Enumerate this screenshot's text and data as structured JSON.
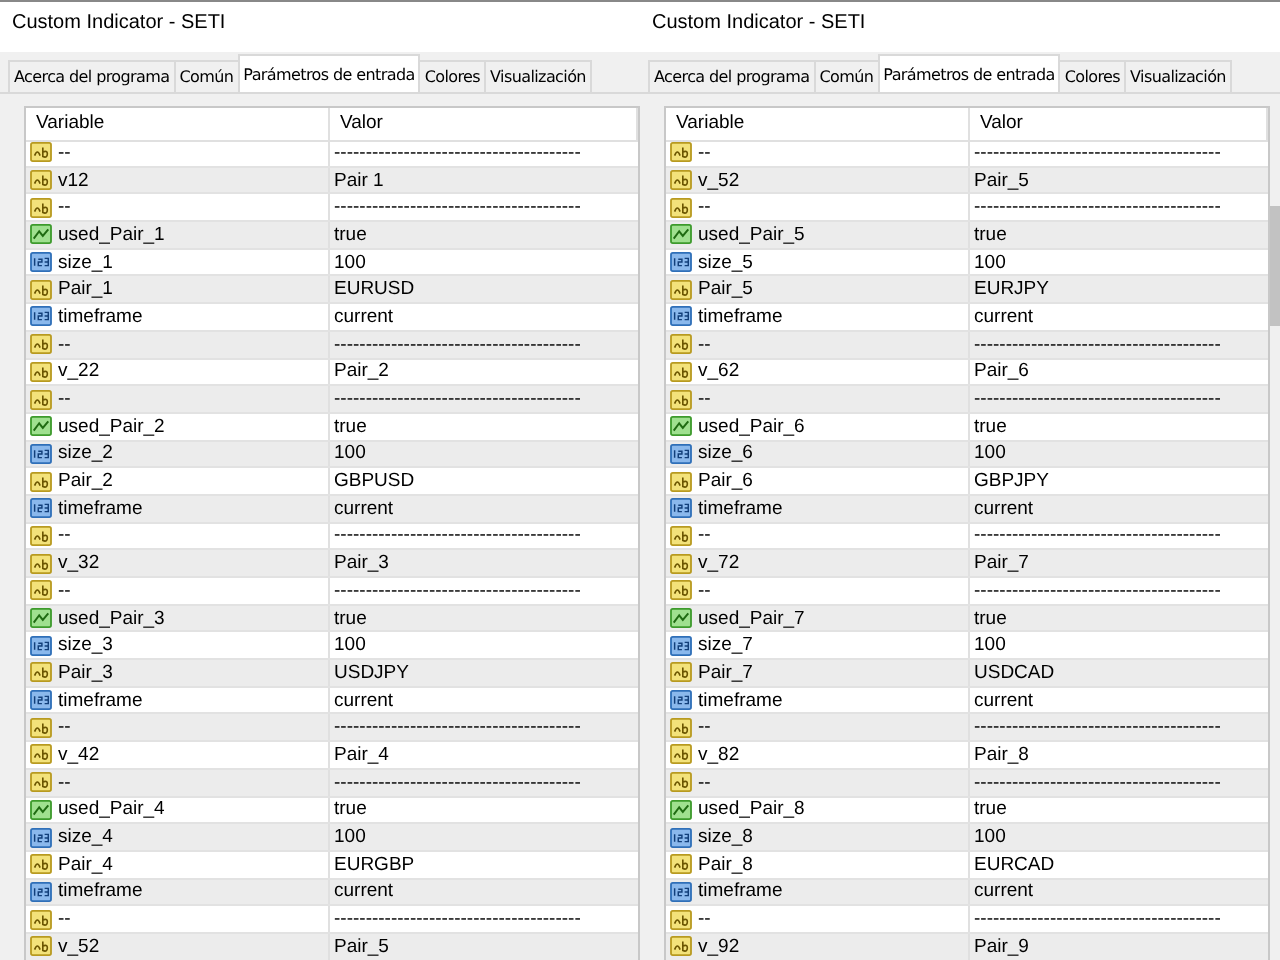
{
  "panels": [
    {
      "window": {
        "title": "Custom Indicator - SETI"
      },
      "tabs": [
        {
          "label": "Acerca del programa",
          "selected": false
        },
        {
          "label": "Común",
          "selected": false
        },
        {
          "label": "Parámetros de entrada",
          "selected": true
        },
        {
          "label": "Colores",
          "selected": false
        },
        {
          "label": "Visualización",
          "selected": false
        }
      ],
      "table": {
        "columns": [
          "Variable",
          "Valor"
        ],
        "rows": [
          {
            "kind": "text",
            "variable": "--",
            "value": "---------------------------------------"
          },
          {
            "kind": "text",
            "variable": "v12",
            "value": "Pair 1"
          },
          {
            "kind": "text",
            "variable": "--",
            "value": "---------------------------------------"
          },
          {
            "kind": "bool",
            "variable": "used_Pair_1",
            "value": "true"
          },
          {
            "kind": "int",
            "variable": "size_1",
            "value": "100"
          },
          {
            "kind": "text",
            "variable": "Pair_1",
            "value": "EURUSD"
          },
          {
            "kind": "int",
            "variable": "timeframe",
            "value": "current"
          },
          {
            "kind": "text",
            "variable": "--",
            "value": "---------------------------------------"
          },
          {
            "kind": "text",
            "variable": "v_22",
            "value": "Pair_2"
          },
          {
            "kind": "text",
            "variable": "--",
            "value": "---------------------------------------"
          },
          {
            "kind": "bool",
            "variable": "used_Pair_2",
            "value": "true"
          },
          {
            "kind": "int",
            "variable": "size_2",
            "value": "100"
          },
          {
            "kind": "text",
            "variable": "Pair_2",
            "value": "GBPUSD"
          },
          {
            "kind": "int",
            "variable": "timeframe",
            "value": "current"
          },
          {
            "kind": "text",
            "variable": "--",
            "value": "---------------------------------------"
          },
          {
            "kind": "text",
            "variable": "v_32",
            "value": "Pair_3"
          },
          {
            "kind": "text",
            "variable": "--",
            "value": "---------------------------------------"
          },
          {
            "kind": "bool",
            "variable": "used_Pair_3",
            "value": "true"
          },
          {
            "kind": "int",
            "variable": "size_3",
            "value": "100"
          },
          {
            "kind": "text",
            "variable": "Pair_3",
            "value": "USDJPY"
          },
          {
            "kind": "int",
            "variable": "timeframe",
            "value": "current"
          },
          {
            "kind": "text",
            "variable": "--",
            "value": "---------------------------------------"
          },
          {
            "kind": "text",
            "variable": "v_42",
            "value": "Pair_4"
          },
          {
            "kind": "text",
            "variable": "--",
            "value": "---------------------------------------"
          },
          {
            "kind": "bool",
            "variable": "used_Pair_4",
            "value": "true"
          },
          {
            "kind": "int",
            "variable": "size_4",
            "value": "100"
          },
          {
            "kind": "text",
            "variable": "Pair_4",
            "value": "EURGBP"
          },
          {
            "kind": "int",
            "variable": "timeframe",
            "value": "current"
          },
          {
            "kind": "text",
            "variable": "--",
            "value": "---------------------------------------"
          },
          {
            "kind": "text",
            "variable": "v_52",
            "value": "Pair_5"
          }
        ]
      }
    },
    {
      "window": {
        "title": "Custom Indicator - SETI"
      },
      "tabs": [
        {
          "label": "Acerca del programa",
          "selected": false
        },
        {
          "label": "Común",
          "selected": false
        },
        {
          "label": "Parámetros de entrada",
          "selected": true
        },
        {
          "label": "Colores",
          "selected": false
        },
        {
          "label": "Visualización",
          "selected": false
        }
      ],
      "table": {
        "columns": [
          "Variable",
          "Valor"
        ],
        "rows": [
          {
            "kind": "text",
            "variable": "--",
            "value": "---------------------------------------"
          },
          {
            "kind": "text",
            "variable": "v_52",
            "value": "Pair_5"
          },
          {
            "kind": "text",
            "variable": "--",
            "value": "---------------------------------------"
          },
          {
            "kind": "bool",
            "variable": "used_Pair_5",
            "value": "true"
          },
          {
            "kind": "int",
            "variable": "size_5",
            "value": "100"
          },
          {
            "kind": "text",
            "variable": "Pair_5",
            "value": "EURJPY"
          },
          {
            "kind": "int",
            "variable": "timeframe",
            "value": "current"
          },
          {
            "kind": "text",
            "variable": "--",
            "value": "---------------------------------------"
          },
          {
            "kind": "text",
            "variable": "v_62",
            "value": "Pair_6"
          },
          {
            "kind": "text",
            "variable": "--",
            "value": "---------------------------------------"
          },
          {
            "kind": "bool",
            "variable": "used_Pair_6",
            "value": "true"
          },
          {
            "kind": "int",
            "variable": "size_6",
            "value": "100"
          },
          {
            "kind": "text",
            "variable": "Pair_6",
            "value": "GBPJPY"
          },
          {
            "kind": "int",
            "variable": "timeframe",
            "value": "current"
          },
          {
            "kind": "text",
            "variable": "--",
            "value": "---------------------------------------"
          },
          {
            "kind": "text",
            "variable": "v_72",
            "value": "Pair_7"
          },
          {
            "kind": "text",
            "variable": "--",
            "value": "---------------------------------------"
          },
          {
            "kind": "bool",
            "variable": "used_Pair_7",
            "value": "true"
          },
          {
            "kind": "int",
            "variable": "size_7",
            "value": "100"
          },
          {
            "kind": "text",
            "variable": "Pair_7",
            "value": "USDCAD"
          },
          {
            "kind": "int",
            "variable": "timeframe",
            "value": "current"
          },
          {
            "kind": "text",
            "variable": "--",
            "value": "---------------------------------------"
          },
          {
            "kind": "text",
            "variable": "v_82",
            "value": "Pair_8"
          },
          {
            "kind": "text",
            "variable": "--",
            "value": "---------------------------------------"
          },
          {
            "kind": "bool",
            "variable": "used_Pair_8",
            "value": "true"
          },
          {
            "kind": "int",
            "variable": "size_8",
            "value": "100"
          },
          {
            "kind": "text",
            "variable": "Pair_8",
            "value": "EURCAD"
          },
          {
            "kind": "int",
            "variable": "timeframe",
            "value": "current"
          },
          {
            "kind": "text",
            "variable": "--",
            "value": "---------------------------------------"
          },
          {
            "kind": "text",
            "variable": "v_92",
            "value": "Pair_9"
          }
        ]
      }
    }
  ]
}
